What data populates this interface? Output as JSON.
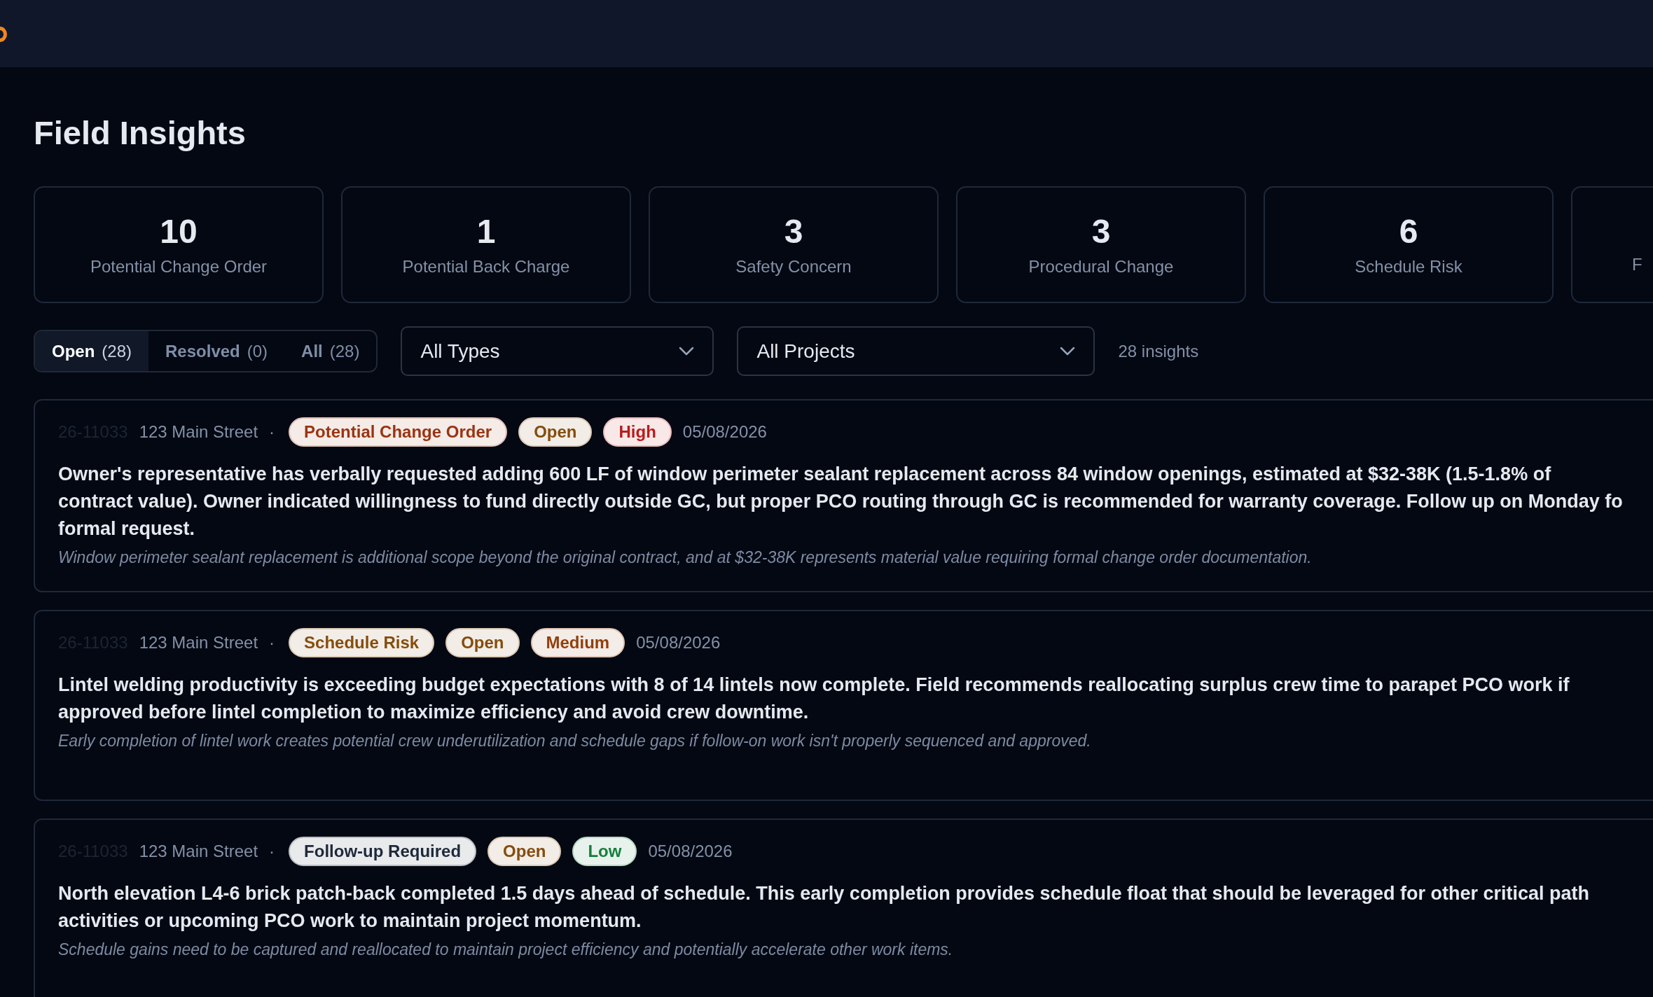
{
  "page_title": "Field Insights",
  "stats": [
    {
      "value": "10",
      "label": "Potential Change Order"
    },
    {
      "value": "1",
      "label": "Potential Back Charge"
    },
    {
      "value": "3",
      "label": "Safety Concern"
    },
    {
      "value": "3",
      "label": "Procedural Change"
    },
    {
      "value": "6",
      "label": "Schedule Risk"
    },
    {
      "label": "F"
    }
  ],
  "status_tabs": [
    {
      "label": "Open",
      "count": "(28)",
      "selected": true
    },
    {
      "label": "Resolved",
      "count": "(0)",
      "selected": false
    },
    {
      "label": "All",
      "count": "(28)",
      "selected": false
    }
  ],
  "type_filter": {
    "value": "All Types"
  },
  "project_filter": {
    "value": "All Projects"
  },
  "result_count": "28 insights",
  "insights": [
    {
      "job_number": "26-11033",
      "project": "123 Main Street",
      "separator": "·",
      "badges": [
        {
          "text": "Potential Change Order",
          "color": "#9a3412"
        },
        {
          "text": "Open",
          "color": "#854d0e"
        },
        {
          "text": "High",
          "color": "#b91c1c"
        }
      ],
      "date": "05/08/2026",
      "description_lines": [
        "Owner's representative has verbally requested adding 600 LF of window perimeter sealant replacement across 84 window openings, estimated at $32-38K (1.5-1.8% of",
        "contract value). Owner indicated willingness to fund directly outside GC, but proper PCO routing through GC is recommended for warranty coverage. Follow up on Monday fo",
        "formal request."
      ],
      "rationale": "Window perimeter sealant replacement is additional scope beyond the original contract, and at $32-38K represents material value requiring formal change order documentation."
    },
    {
      "job_number": "26-11033",
      "project": "123 Main Street",
      "separator": "·",
      "badges": [
        {
          "text": "Schedule Risk",
          "color": "#854d0e"
        },
        {
          "text": "Open",
          "color": "#854d0e"
        },
        {
          "text": "Medium",
          "color": "#92400e"
        }
      ],
      "date": "05/08/2026",
      "description_lines": [
        "Lintel welding productivity is exceeding budget expectations with 8 of 14 lintels now complete. Field recommends reallocating surplus crew time to parapet PCO work if",
        "approved before lintel completion to maximize efficiency and avoid crew downtime."
      ],
      "rationale": "Early completion of lintel work creates potential crew underutilization and schedule gaps if follow-on work isn't properly sequenced and approved."
    },
    {
      "job_number": "26-11033",
      "project": "123 Main Street",
      "separator": "·",
      "badges": [
        {
          "text": "Follow-up Required",
          "color": "#1e293b"
        },
        {
          "text": "Open",
          "color": "#854d0e"
        },
        {
          "text": "Low",
          "color": "#15803d"
        }
      ],
      "date": "05/08/2026",
      "description_lines": [
        "North elevation L4-6 brick patch-back completed 1.5 days ahead of schedule. This early completion provides schedule float that should be leveraged for other critical path",
        "activities or upcoming PCO work to maintain project momentum."
      ],
      "rationale": "Schedule gains need to be captured and reallocated to maintain project efficiency and potentially accelerate other work items."
    }
  ]
}
